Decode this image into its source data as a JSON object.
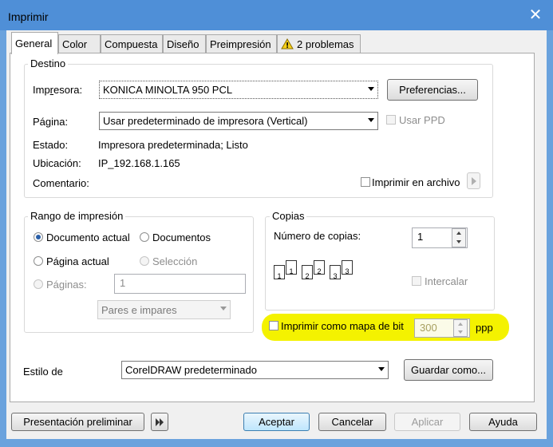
{
  "window": {
    "title": "Imprimir"
  },
  "tabs": [
    {
      "label": "General"
    },
    {
      "label": "Color"
    },
    {
      "label": "Compuesta"
    },
    {
      "label": "Diseño"
    },
    {
      "label": "Preimpresión"
    },
    {
      "label": "2 problemas"
    }
  ],
  "destino": {
    "title": "Destino",
    "impresora_label": "Impresora:",
    "impresora_value": "KONICA MINOLTA 950 PCL",
    "preferencias_label": "Preferencias...",
    "pagina_label": "Página:",
    "pagina_value": "Usar predeterminado de impresora (Vertical)",
    "usar_ppd_label": "Usar PPD",
    "estado_label": "Estado:",
    "estado_value": "Impresora predeterminada; Listo",
    "ubicacion_label": "Ubicación:",
    "ubicacion_value": "IP_192.168.1.165",
    "comentario_label": "Comentario:",
    "imprimir_archivo_label": "Imprimir en archivo"
  },
  "rango": {
    "title": "Rango de impresión",
    "documento_actual": "Documento actual",
    "documentos": "Documentos",
    "pagina_actual": "Página actual",
    "seleccion": "Selección",
    "paginas_label": "Páginas:",
    "paginas_value": "1",
    "pares_impares": "Pares e impares"
  },
  "copias": {
    "title": "Copias",
    "numero_label": "Número de copias:",
    "numero_value": "1",
    "intercalar_label": "Intercalar",
    "collate_pages": [
      "1",
      "1",
      "2",
      "2",
      "3",
      "3"
    ]
  },
  "bitmap": {
    "label": "Imprimir como mapa de bit",
    "dpi_value": "300",
    "unit": "ppp",
    "highlight_color": "#f4f200"
  },
  "estilo": {
    "label": "Estilo de",
    "value": "CorelDRAW predeterminado",
    "guardar_label": "Guardar como..."
  },
  "footer": {
    "presentacion_label": "Presentación preliminar",
    "aceptar_label": "Aceptar",
    "cancelar_label": "Cancelar",
    "aplicar_label": "Aplicar",
    "ayuda_label": "Ayuda"
  }
}
